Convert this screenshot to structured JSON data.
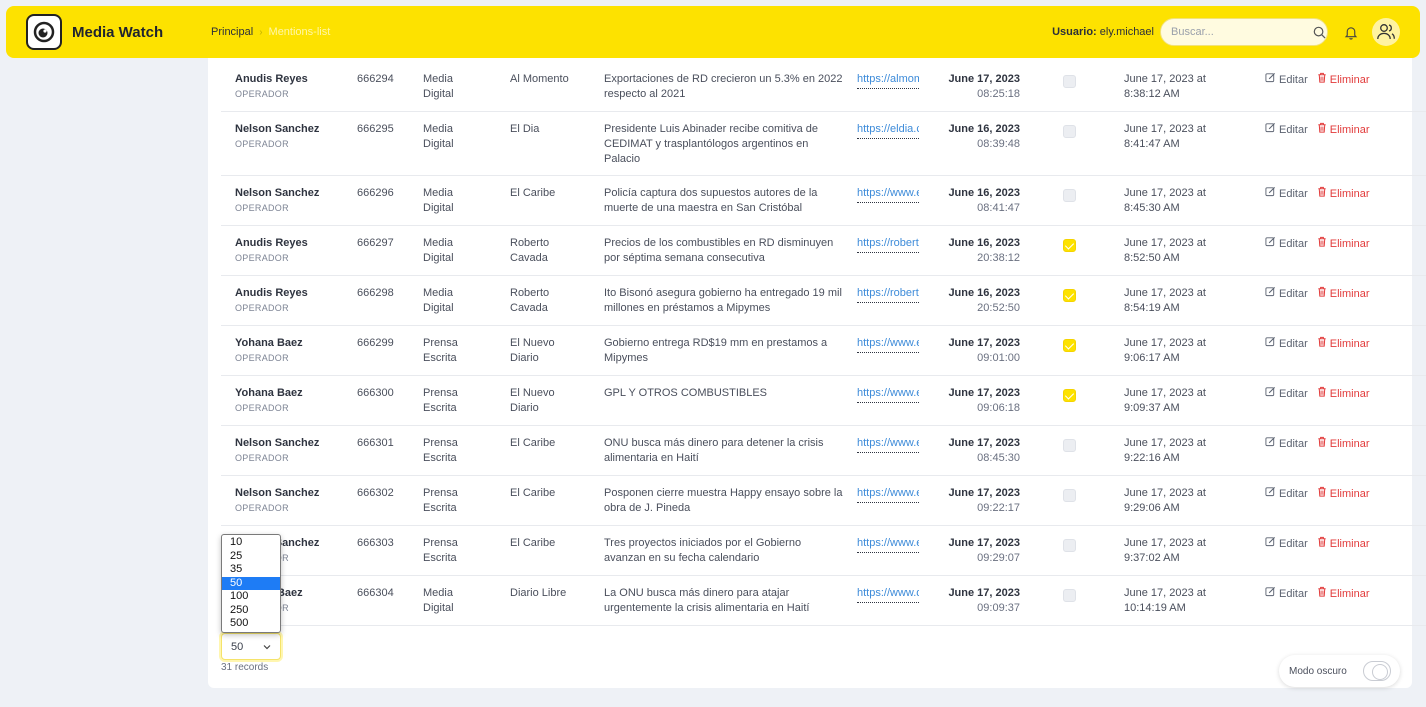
{
  "app": {
    "name": "Media Watch"
  },
  "breadcrumb": {
    "home": "Principal",
    "current": "Mentions-list"
  },
  "user": {
    "label": "Usuario:",
    "name": "ely.michael"
  },
  "search": {
    "placeholder": "Buscar..."
  },
  "actions": {
    "edit_label": "Editar",
    "delete_label": "Eliminar"
  },
  "rows": [
    {
      "name": "Anudis Reyes",
      "role": "OPERADOR",
      "id": "666294",
      "type1": "Media",
      "type2": "Digital",
      "source1": "Al Momento",
      "source2": "",
      "title": "Exportaciones de RD crecieron un 5.3% en 2022 respecto al 2021",
      "link": "https://almomento.net",
      "date": "June 17, 2023",
      "time": "08:25:18",
      "checked": false,
      "created1": "June 17, 2023 at",
      "created2": "8:38:12 AM"
    },
    {
      "name": "Nelson Sanchez",
      "role": "OPERADOR",
      "id": "666295",
      "type1": "Media",
      "type2": "Digital",
      "source1": "El Dia",
      "source2": "",
      "title": "Presidente Luis Abinader recibe comitiva de CEDIMAT y trasplantólogos argentinos en Palacio",
      "link": "https://eldia.com.do",
      "date": "June 16, 2023",
      "time": "08:39:48",
      "checked": false,
      "created1": "June 17, 2023 at",
      "created2": "8:41:47 AM"
    },
    {
      "name": "Nelson Sanchez",
      "role": "OPERADOR",
      "id": "666296",
      "type1": "Media",
      "type2": "Digital",
      "source1": "El Caribe",
      "source2": "",
      "title": "Policía captura dos supuestos autores de la muerte de una maestra en San Cristóbal",
      "link": "https://www.elcaribe.com.do",
      "date": "June 16, 2023",
      "time": "08:41:47",
      "checked": false,
      "created1": "June 17, 2023 at",
      "created2": "8:45:30 AM"
    },
    {
      "name": "Anudis Reyes",
      "role": "OPERADOR",
      "id": "666297",
      "type1": "Media",
      "type2": "Digital",
      "source1": "Roberto",
      "source2": "Cavada",
      "title": "Precios de los combustibles en RD disminuyen por séptima semana consecutiva",
      "link": "https://robertocavada.com",
      "date": "June 16, 2023",
      "time": "20:38:12",
      "checked": true,
      "created1": "June 17, 2023 at",
      "created2": "8:52:50 AM"
    },
    {
      "name": "Anudis Reyes",
      "role": "OPERADOR",
      "id": "666298",
      "type1": "Media",
      "type2": "Digital",
      "source1": "Roberto",
      "source2": "Cavada",
      "title": "Ito Bisonó asegura gobierno ha entregado 19 mil millones en préstamos a Mipymes",
      "link": "https://robertocavada.com",
      "date": "June 16, 2023",
      "time": "20:52:50",
      "checked": true,
      "created1": "June 17, 2023 at",
      "created2": "8:54:19 AM"
    },
    {
      "name": "Yohana Baez",
      "role": "OPERADOR",
      "id": "666299",
      "type1": "Prensa",
      "type2": "Escrita",
      "source1": "El Nuevo",
      "source2": "Diario",
      "title": "Gobierno entrega RD$19 mm en prestamos a Mipymes",
      "link": "https://www.elnuevodiario.com.do",
      "date": "June 17, 2023",
      "time": "09:01:00",
      "checked": true,
      "created1": "June 17, 2023 at",
      "created2": "9:06:17 AM"
    },
    {
      "name": "Yohana Baez",
      "role": "OPERADOR",
      "id": "666300",
      "type1": "Prensa",
      "type2": "Escrita",
      "source1": "El Nuevo",
      "source2": "Diario",
      "title": "GPL Y OTROS COMBUSTIBLES",
      "link": "https://www.elnuevodiario.com.do",
      "date": "June 17, 2023",
      "time": "09:06:18",
      "checked": true,
      "created1": "June 17, 2023 at",
      "created2": "9:09:37 AM"
    },
    {
      "name": "Nelson Sanchez",
      "role": "OPERADOR",
      "id": "666301",
      "type1": "Prensa",
      "type2": "Escrita",
      "source1": "El Caribe",
      "source2": "",
      "title": "ONU busca más dinero para detener la crisis alimentaria en Haití",
      "link": "https://www.elcaribe.com.do",
      "date": "June 17, 2023",
      "time": "08:45:30",
      "checked": false,
      "created1": "June 17, 2023 at",
      "created2": "9:22:16 AM"
    },
    {
      "name": "Nelson Sanchez",
      "role": "OPERADOR",
      "id": "666302",
      "type1": "Prensa",
      "type2": "Escrita",
      "source1": "El Caribe",
      "source2": "",
      "title": "Posponen cierre muestra Happy ensayo sobre la obra de J. Pineda",
      "link": "https://www.elcaribe.com.do",
      "date": "June 17, 2023",
      "time": "09:22:17",
      "checked": false,
      "created1": "June 17, 2023 at",
      "created2": "9:29:06 AM"
    },
    {
      "name": "Nelson Sanchez",
      "role": "OPERADOR",
      "id": "666303",
      "type1": "Prensa",
      "type2": "Escrita",
      "source1": "El Caribe",
      "source2": "",
      "title": "Tres proyectos iniciados por el Gobierno avanzan en su fecha calendario",
      "link": "https://www.elcaribe.com.do",
      "date": "June 17, 2023",
      "time": "09:29:07",
      "checked": false,
      "created1": "June 17, 2023 at",
      "created2": "9:37:02 AM"
    },
    {
      "name": "Yohana Baez",
      "role": "OPERADOR",
      "id": "666304",
      "type1": "Media",
      "type2": "Digital",
      "source1": "Diario Libre",
      "source2": "",
      "title": "La ONU busca más dinero para atajar urgentemente la crisis alimentaria en Haití",
      "link": "https://www.diariolibre.com",
      "date": "June 17, 2023",
      "time": "09:09:37",
      "checked": false,
      "created1": "June 17, 2023 at",
      "created2": "10:14:19 AM"
    }
  ],
  "pagination": {
    "page_size": "50",
    "options": [
      "10",
      "25",
      "35",
      "50",
      "100",
      "250",
      "500"
    ],
    "selected_option": "50",
    "records_text": "31 records"
  },
  "dark_mode": {
    "label": "Modo oscuro",
    "enabled": false
  },
  "colors": {
    "brand": "#fde200",
    "link": "#3d8bd9",
    "danger": "#e23b3b",
    "selected_option": "#1e7cf5"
  }
}
